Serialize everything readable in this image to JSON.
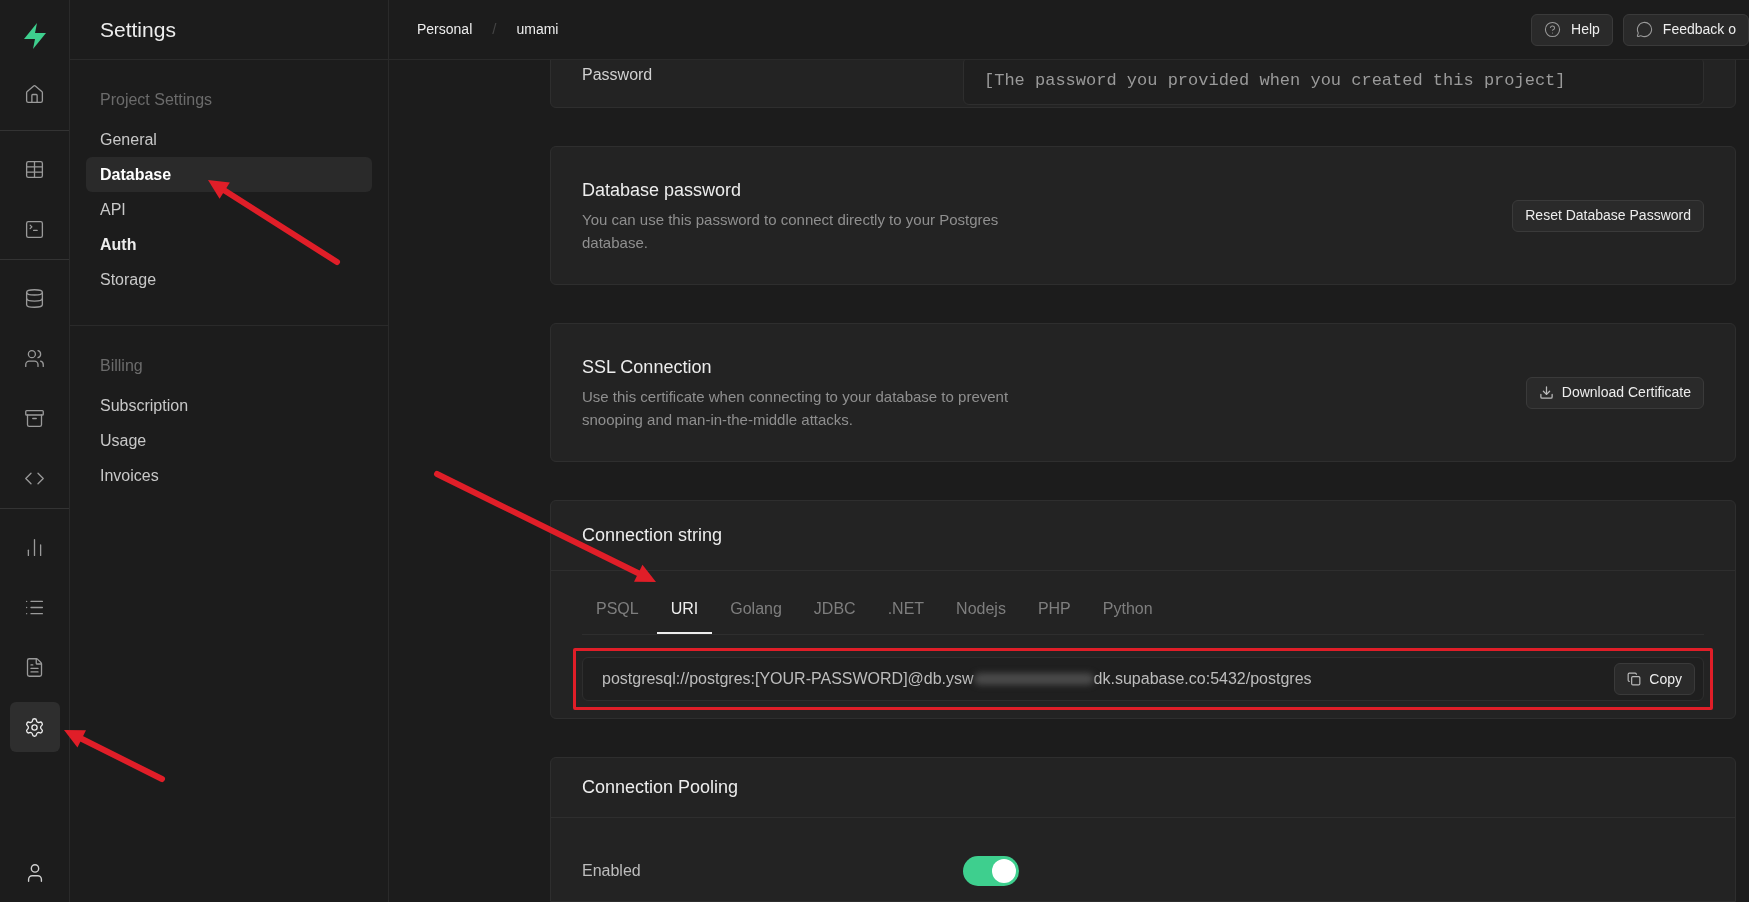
{
  "rail": {
    "groups": [
      [
        {
          "selected": false
        }
      ],
      [
        {
          "selected": false
        },
        {
          "selected": false
        }
      ],
      [
        {
          "selected": false
        },
        {
          "selected": false
        },
        {
          "selected": false
        },
        {
          "selected": false
        }
      ],
      [
        {
          "selected": false
        },
        {
          "selected": false
        },
        {
          "selected": false
        },
        {
          "selected": true
        }
      ]
    ]
  },
  "sidebar": {
    "title": "Settings",
    "sections": [
      {
        "heading": "Project Settings",
        "items": [
          {
            "label": "General",
            "selected": false,
            "hovered": false
          },
          {
            "label": "Database",
            "selected": true,
            "hovered": true
          },
          {
            "label": "API",
            "selected": false,
            "hovered": false
          },
          {
            "label": "Auth",
            "selected": false,
            "hovered": true
          },
          {
            "label": "Storage",
            "selected": false,
            "hovered": false
          }
        ]
      },
      {
        "heading": "Billing",
        "items": [
          {
            "label": "Subscription",
            "selected": false,
            "hovered": false
          },
          {
            "label": "Usage",
            "selected": false,
            "hovered": false
          },
          {
            "label": "Invoices",
            "selected": false,
            "hovered": false
          }
        ]
      }
    ]
  },
  "topbar": {
    "breadcrumb": [
      "Personal",
      "umami"
    ],
    "separator": "/",
    "buttons": [
      {
        "label": "Help"
      },
      {
        "label": "Feedback o"
      }
    ]
  },
  "cards": [
    {
      "kind": "field",
      "label": "Password",
      "value": "[The password you provided when you created this project]"
    },
    {
      "kind": "action",
      "title": "Database password",
      "description": "You can use this password to connect directly to your Postgres database.",
      "button": "Reset Database Password"
    },
    {
      "kind": "action",
      "title": "SSL Connection",
      "description": "Use this certificate when connecting to your database to prevent snooping and man-in-the-middle attacks.",
      "button": "Download Certificate"
    },
    {
      "kind": "tabs",
      "title": "Connection string",
      "tabs": [
        {
          "label": "PSQL",
          "selected": false
        },
        {
          "label": "URI",
          "selected": true
        },
        {
          "label": "Golang",
          "selected": false
        },
        {
          "label": "JDBC",
          "selected": false
        },
        {
          "label": ".NET",
          "selected": false
        },
        {
          "label": "Nodejs",
          "selected": false
        },
        {
          "label": "PHP",
          "selected": false
        },
        {
          "label": "Python",
          "selected": false
        }
      ],
      "value_start": "postgresql://postgres:[YOUR-PASSWORD]@db.ysw",
      "value_end": "dk.supabase.co:5432/postgres",
      "button": "Copy",
      "highlighted": true
    },
    {
      "kind": "toggle",
      "title": "Connection Pooling",
      "label": "Enabled",
      "on": true
    }
  ]
}
